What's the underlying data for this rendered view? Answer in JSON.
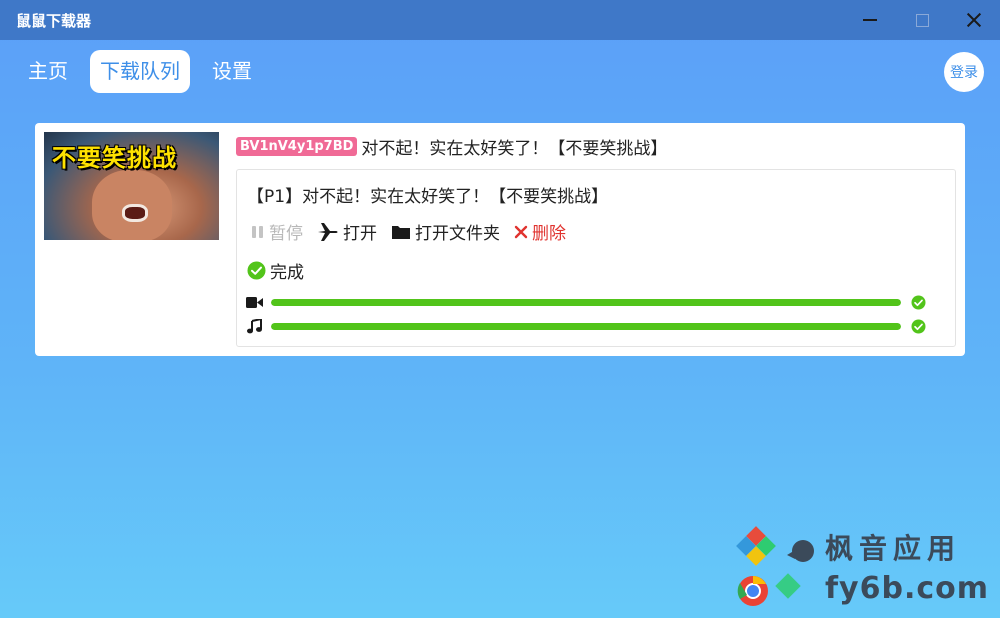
{
  "window": {
    "title": "鼠鼠下载器",
    "controls": [
      "minimize-icon",
      "maximize-icon",
      "close-icon"
    ]
  },
  "nav": {
    "tabs": [
      {
        "label": "主页",
        "active": false
      },
      {
        "label": "下载队列",
        "active": true
      },
      {
        "label": "设置",
        "active": false
      }
    ],
    "login_label": "登录"
  },
  "queue": {
    "items": [
      {
        "bvid": "BV1nV4y1p7BD",
        "title": "对不起！实在太好笑了！【不要笑挑战】",
        "thumbnail_caption": "不要笑挑战",
        "parts": [
          {
            "title": "【P1】对不起！实在太好笑了！【不要笑挑战】",
            "actions": {
              "pause": "暂停",
              "open": "打开",
              "open_folder": "打开文件夹",
              "delete": "删除"
            },
            "status": "完成",
            "video_progress": 1.0,
            "audio_progress": 1.0
          }
        ]
      }
    ]
  },
  "colors": {
    "title_bar": "#3f78c8",
    "accent": "#3e8fe8",
    "badge": "#f06a96",
    "success": "#52c41a",
    "danger": "#e0332f"
  },
  "watermark": {
    "cn": "枫音应用",
    "url": "fy6b.com"
  }
}
